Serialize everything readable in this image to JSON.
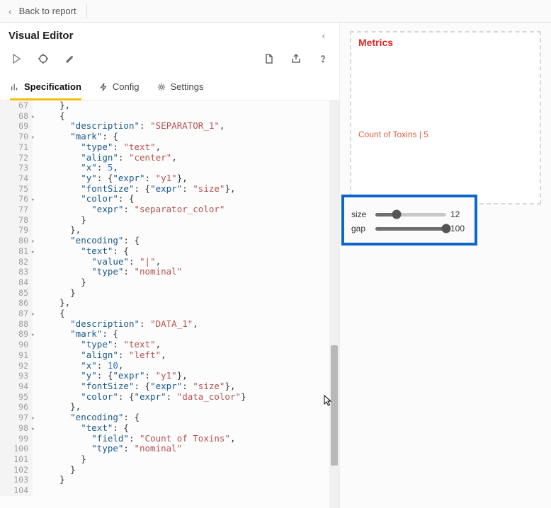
{
  "topbar": {
    "back_label": "Back to report"
  },
  "editor": {
    "title": "Visual Editor",
    "tabs": {
      "specification": "Specification",
      "config": "Config",
      "settings": "Settings"
    }
  },
  "metrics": {
    "title": "Metrics",
    "output": "Count of Toxins | 5"
  },
  "sliders": {
    "size": {
      "label": "size",
      "value": "12",
      "pct": 30
    },
    "gap": {
      "label": "gap",
      "value": "100",
      "pct": 100
    }
  },
  "code_lines": [
    {
      "n": 67,
      "f": false,
      "tokens": [
        [
          "p",
          "    },"
        ]
      ]
    },
    {
      "n": 68,
      "f": true,
      "tokens": [
        [
          "p",
          "    {"
        ]
      ]
    },
    {
      "n": 69,
      "f": false,
      "tokens": [
        [
          "p",
          "      "
        ],
        [
          "k",
          "\"description\""
        ],
        [
          "p",
          ": "
        ],
        [
          "s",
          "\"SEPARATOR_1\""
        ],
        [
          "p",
          ","
        ]
      ]
    },
    {
      "n": 70,
      "f": true,
      "tokens": [
        [
          "p",
          "      "
        ],
        [
          "k",
          "\"mark\""
        ],
        [
          "p",
          ": {"
        ]
      ]
    },
    {
      "n": 71,
      "f": false,
      "tokens": [
        [
          "p",
          "        "
        ],
        [
          "k",
          "\"type\""
        ],
        [
          "p",
          ": "
        ],
        [
          "s",
          "\"text\""
        ],
        [
          "p",
          ","
        ]
      ]
    },
    {
      "n": 72,
      "f": false,
      "tokens": [
        [
          "p",
          "        "
        ],
        [
          "k",
          "\"align\""
        ],
        [
          "p",
          ": "
        ],
        [
          "s",
          "\"center\""
        ],
        [
          "p",
          ","
        ]
      ]
    },
    {
      "n": 73,
      "f": false,
      "tokens": [
        [
          "p",
          "        "
        ],
        [
          "k",
          "\"x\""
        ],
        [
          "p",
          ": "
        ],
        [
          "n",
          "5"
        ],
        [
          "p",
          ","
        ]
      ]
    },
    {
      "n": 74,
      "f": false,
      "tokens": [
        [
          "p",
          "        "
        ],
        [
          "k",
          "\"y\""
        ],
        [
          "p",
          ": {"
        ],
        [
          "k",
          "\"expr\""
        ],
        [
          "p",
          ": "
        ],
        [
          "s",
          "\"y1\""
        ],
        [
          "p",
          "},"
        ]
      ]
    },
    {
      "n": 75,
      "f": false,
      "tokens": [
        [
          "p",
          "        "
        ],
        [
          "k",
          "\"fontSize\""
        ],
        [
          "p",
          ": {"
        ],
        [
          "k",
          "\"expr\""
        ],
        [
          "p",
          ": "
        ],
        [
          "s",
          "\"size\""
        ],
        [
          "p",
          "},"
        ]
      ]
    },
    {
      "n": 76,
      "f": true,
      "tokens": [
        [
          "p",
          "        "
        ],
        [
          "k",
          "\"color\""
        ],
        [
          "p",
          ": {"
        ]
      ]
    },
    {
      "n": 77,
      "f": false,
      "tokens": [
        [
          "p",
          "          "
        ],
        [
          "k",
          "\"expr\""
        ],
        [
          "p",
          ": "
        ],
        [
          "s",
          "\"separator_color\""
        ]
      ]
    },
    {
      "n": 78,
      "f": false,
      "tokens": [
        [
          "p",
          "        }"
        ]
      ]
    },
    {
      "n": 79,
      "f": false,
      "tokens": [
        [
          "p",
          "      },"
        ]
      ]
    },
    {
      "n": 80,
      "f": true,
      "tokens": [
        [
          "p",
          "      "
        ],
        [
          "k",
          "\"encoding\""
        ],
        [
          "p",
          ": {"
        ]
      ]
    },
    {
      "n": 81,
      "f": true,
      "tokens": [
        [
          "p",
          "        "
        ],
        [
          "k",
          "\"text\""
        ],
        [
          "p",
          ": {"
        ]
      ]
    },
    {
      "n": 82,
      "f": false,
      "tokens": [
        [
          "p",
          "          "
        ],
        [
          "k",
          "\"value\""
        ],
        [
          "p",
          ": "
        ],
        [
          "s",
          "\"|\""
        ],
        [
          "p",
          ","
        ]
      ]
    },
    {
      "n": 83,
      "f": false,
      "tokens": [
        [
          "p",
          "          "
        ],
        [
          "k",
          "\"type\""
        ],
        [
          "p",
          ": "
        ],
        [
          "s",
          "\"nominal\""
        ]
      ]
    },
    {
      "n": 84,
      "f": false,
      "tokens": [
        [
          "p",
          "        }"
        ]
      ]
    },
    {
      "n": 85,
      "f": false,
      "tokens": [
        [
          "p",
          "      }"
        ]
      ]
    },
    {
      "n": 86,
      "f": false,
      "tokens": [
        [
          "p",
          "    },"
        ]
      ]
    },
    {
      "n": 87,
      "f": true,
      "tokens": [
        [
          "p",
          "    {"
        ]
      ]
    },
    {
      "n": 88,
      "f": false,
      "tokens": [
        [
          "p",
          "      "
        ],
        [
          "k",
          "\"description\""
        ],
        [
          "p",
          ": "
        ],
        [
          "s",
          "\"DATA_1\""
        ],
        [
          "p",
          ","
        ]
      ]
    },
    {
      "n": 89,
      "f": true,
      "tokens": [
        [
          "p",
          "      "
        ],
        [
          "k",
          "\"mark\""
        ],
        [
          "p",
          ": {"
        ]
      ]
    },
    {
      "n": 90,
      "f": false,
      "tokens": [
        [
          "p",
          "        "
        ],
        [
          "k",
          "\"type\""
        ],
        [
          "p",
          ": "
        ],
        [
          "s",
          "\"text\""
        ],
        [
          "p",
          ","
        ]
      ]
    },
    {
      "n": 91,
      "f": false,
      "tokens": [
        [
          "p",
          "        "
        ],
        [
          "k",
          "\"align\""
        ],
        [
          "p",
          ": "
        ],
        [
          "s",
          "\"left\""
        ],
        [
          "p",
          ","
        ]
      ]
    },
    {
      "n": 92,
      "f": false,
      "tokens": [
        [
          "p",
          "        "
        ],
        [
          "k",
          "\"x\""
        ],
        [
          "p",
          ": "
        ],
        [
          "n",
          "10"
        ],
        [
          "p",
          ","
        ]
      ]
    },
    {
      "n": 93,
      "f": false,
      "tokens": [
        [
          "p",
          "        "
        ],
        [
          "k",
          "\"y\""
        ],
        [
          "p",
          ": {"
        ],
        [
          "k",
          "\"expr\""
        ],
        [
          "p",
          ": "
        ],
        [
          "s",
          "\"y1\""
        ],
        [
          "p",
          "},"
        ]
      ]
    },
    {
      "n": 94,
      "f": false,
      "tokens": [
        [
          "p",
          "        "
        ],
        [
          "k",
          "\"fontSize\""
        ],
        [
          "p",
          ": {"
        ],
        [
          "k",
          "\"expr\""
        ],
        [
          "p",
          ": "
        ],
        [
          "s",
          "\"size\""
        ],
        [
          "p",
          "},"
        ]
      ]
    },
    {
      "n": 95,
      "f": false,
      "tokens": [
        [
          "p",
          "        "
        ],
        [
          "k",
          "\"color\""
        ],
        [
          "p",
          ": {"
        ],
        [
          "k",
          "\"expr\""
        ],
        [
          "p",
          ": "
        ],
        [
          "s",
          "\"data_color\""
        ],
        [
          "p",
          "}"
        ]
      ]
    },
    {
      "n": 96,
      "f": false,
      "tokens": [
        [
          "p",
          "      },"
        ]
      ]
    },
    {
      "n": 97,
      "f": true,
      "tokens": [
        [
          "p",
          "      "
        ],
        [
          "k",
          "\"encoding\""
        ],
        [
          "p",
          ": {"
        ]
      ]
    },
    {
      "n": 98,
      "f": true,
      "tokens": [
        [
          "p",
          "        "
        ],
        [
          "k",
          "\"text\""
        ],
        [
          "p",
          ": {"
        ]
      ]
    },
    {
      "n": 99,
      "f": false,
      "tokens": [
        [
          "p",
          "          "
        ],
        [
          "k",
          "\"field\""
        ],
        [
          "p",
          ": "
        ],
        [
          "s",
          "\"Count of Toxins\""
        ],
        [
          "p",
          ","
        ]
      ]
    },
    {
      "n": 100,
      "f": false,
      "tokens": [
        [
          "p",
          "          "
        ],
        [
          "k",
          "\"type\""
        ],
        [
          "p",
          ": "
        ],
        [
          "s",
          "\"nominal\""
        ]
      ]
    },
    {
      "n": 101,
      "f": false,
      "tokens": [
        [
          "p",
          "        }"
        ]
      ]
    },
    {
      "n": 102,
      "f": false,
      "tokens": [
        [
          "p",
          "      }"
        ]
      ]
    },
    {
      "n": 103,
      "f": false,
      "tokens": [
        [
          "p",
          "    }"
        ]
      ]
    },
    {
      "n": 104,
      "f": false,
      "tokens": [
        [
          "p",
          ""
        ]
      ]
    }
  ]
}
